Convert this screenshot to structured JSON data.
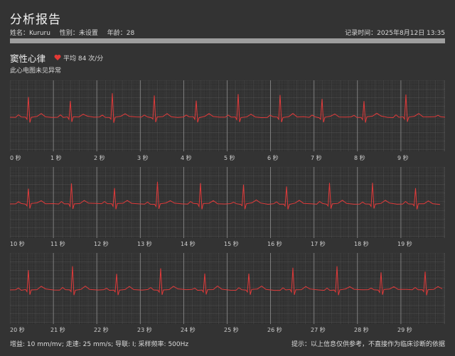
{
  "header": {
    "title": "分析报告",
    "name": "姓名：Kururu",
    "gender": "性别：未设置",
    "age": "年龄：28",
    "record_time": "记录时间：2025年8月12日 13:35"
  },
  "rhythm": {
    "label": "窦性心律",
    "average": "平均 84 次/分",
    "conclusion": "此心电图未见异常"
  },
  "colors": {
    "background": "#333333",
    "trace": "#e03a3a",
    "grid": "#4a4a4a",
    "accent": "#e53935"
  },
  "strips": [
    {
      "ticks": [
        "0 秒",
        "1 秒",
        "2 秒",
        "3 秒",
        "4 秒",
        "5 秒",
        "6 秒",
        "7 秒",
        "8 秒",
        "9 秒"
      ]
    },
    {
      "ticks": [
        "10 秒",
        "11 秒",
        "12 秒",
        "13 秒",
        "14 秒",
        "15 秒",
        "16 秒",
        "17 秒",
        "18 秒",
        "19 秒"
      ]
    },
    {
      "ticks": [
        "20 秒",
        "21 秒",
        "22 秒",
        "23 秒",
        "24 秒",
        "25 秒",
        "26 秒",
        "27 秒",
        "28 秒",
        "29 秒"
      ]
    }
  ],
  "footer": {
    "settings": "增益: 10 mm/mv; 走速: 25 mm/s; 导联: I; 采样频率: 500Hz",
    "note": "提示：以上信息仅供参考，不直接作为临床诊断的依据"
  }
}
